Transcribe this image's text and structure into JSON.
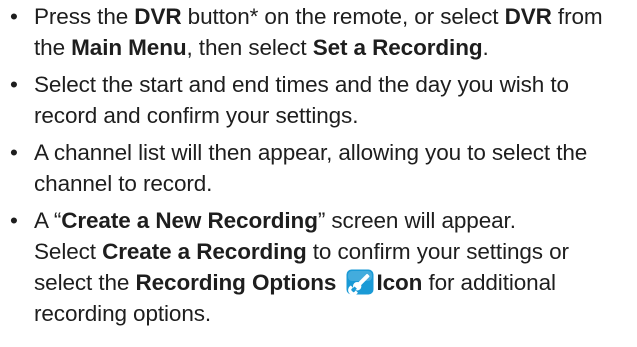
{
  "items": [
    {
      "parts": [
        {
          "text": "Press the "
        },
        {
          "text": "DVR",
          "bold": true
        },
        {
          "text": " button* on the remote, or select "
        },
        {
          "text": "DVR",
          "bold": true
        },
        {
          "text": " from the "
        },
        {
          "text": "Main Menu",
          "bold": true
        },
        {
          "text": ", then select "
        },
        {
          "text": "Set a Recording",
          "bold": true
        },
        {
          "text": "."
        }
      ]
    },
    {
      "parts": [
        {
          "text": "Select the start and end times and the day you wish to record and confirm your settings."
        }
      ]
    },
    {
      "parts": [
        {
          "text": "A channel list will then appear, allowing you to select the channel to record."
        }
      ]
    },
    {
      "parts": [
        {
          "text": "A “"
        },
        {
          "text": "Create a New Recording",
          "bold": true
        },
        {
          "text": "” screen will appear. "
        },
        {
          "br": true
        },
        {
          "text": "Select "
        },
        {
          "text": "Create a Recording",
          "bold": true
        },
        {
          "text": " to confirm your settings or select the "
        },
        {
          "text": "Recording Options",
          "bold": true
        },
        {
          "text": " "
        },
        {
          "icon": "wrench-icon"
        },
        {
          "text": "Icon",
          "bold": true
        },
        {
          "text": " for additional recording options."
        }
      ]
    }
  ],
  "colors": {
    "text": "#1e1e1e",
    "icon_bg": "#1a9ad6",
    "icon_glyph": "#ffffff"
  }
}
